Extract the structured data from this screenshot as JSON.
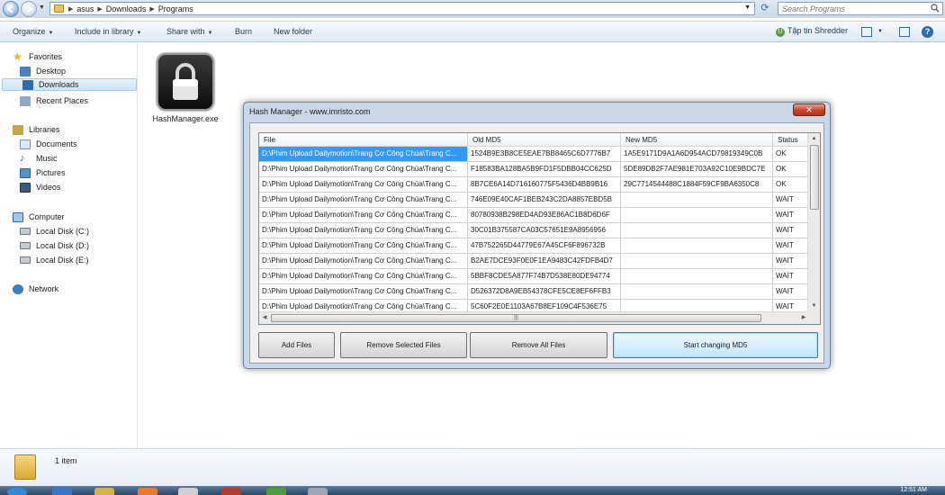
{
  "address": {
    "breadcrumb": [
      "asus",
      "Downloads",
      "Programs"
    ],
    "search_placeholder": "Search Programs"
  },
  "toolbar": {
    "organize": "Organize",
    "include_in_library": "Include in library",
    "share_with": "Share with",
    "burn": "Burn",
    "new_folder": "New folder",
    "shredder": "Tập tin Shredder"
  },
  "sidebar": {
    "favorites": "Favorites",
    "desktop": "Desktop",
    "downloads": "Downloads",
    "recent_places": "Recent Places",
    "libraries": "Libraries",
    "documents": "Documents",
    "music": "Music",
    "pictures": "Pictures",
    "videos": "Videos",
    "computer": "Computer",
    "disk_c": "Local Disk (C:)",
    "disk_d": "Local Disk (D:)",
    "disk_e": "Local Disk (E:)",
    "network": "Network"
  },
  "content": {
    "file_name": "HashManager.exe"
  },
  "dialog": {
    "title": "Hash Manager - www.imristo.com",
    "columns": [
      "File",
      "Old MD5",
      "New MD5",
      "Status"
    ],
    "rows": [
      {
        "file": "D:\\Phim Upload Dailymotion\\Trang Cơ Công Chúa\\Trang C...",
        "old": "1524B9E3B8CE5EAE7BB8465C6D7776B7",
        "new": "1A5E9171D9A1A6D954ACD79819349C0B",
        "status": "OK"
      },
      {
        "file": "D:\\Phim Upload Dailymotion\\Trang Cơ Công Chúa\\Trang C...",
        "old": "F18583BA128BA5B9FD1F5DBB04CC625D",
        "new": "5DE89DB2F7AE981E703A92C10E9BDC7E",
        "status": "OK"
      },
      {
        "file": "D:\\Phim Upload Dailymotion\\Trang Cơ Công Chúa\\Trang C...",
        "old": "8B7CE6A14D716160775F5436D4BB9B16",
        "new": "29C7714544488C1884F59CF9BA6350C8",
        "status": "OK"
      },
      {
        "file": "D:\\Phim Upload Dailymotion\\Trang Cơ Công Chúa\\Trang C...",
        "old": "746E09E40CAF1BEB243C2DA8857EBD5B",
        "new": "",
        "status": "WAIT"
      },
      {
        "file": "D:\\Phim Upload Dailymotion\\Trang Cơ Công Chúa\\Trang C...",
        "old": "80780938B298ED4AD93E86AC1B8D6D6F",
        "new": "",
        "status": "WAIT"
      },
      {
        "file": "D:\\Phim Upload Dailymotion\\Trang Cơ Công Chúa\\Trang C...",
        "old": "30C01B375587CA03C57651E9A8956956",
        "new": "",
        "status": "WAIT"
      },
      {
        "file": "D:\\Phim Upload Dailymotion\\Trang Cơ Công Chúa\\Trang C...",
        "old": "47B752265D44779E67A45CF6F896732B",
        "new": "",
        "status": "WAIT"
      },
      {
        "file": "D:\\Phim Upload Dailymotion\\Trang Cơ Công Chúa\\Trang C...",
        "old": "B2AE7DCE93F0E0F1EA9483C42FDFB4D7",
        "new": "",
        "status": "WAIT"
      },
      {
        "file": "D:\\Phim Upload Dailymotion\\Trang Cơ Công Chúa\\Trang C...",
        "old": "5BBF8CDE5A877F74B7D538E80DE94774",
        "new": "",
        "status": "WAIT"
      },
      {
        "file": "D:\\Phim Upload Dailymotion\\Trang Cơ Công Chúa\\Trang C...",
        "old": "D526372D8A9EB54378CFE5CE8EF6FFB3",
        "new": "",
        "status": "WAIT"
      },
      {
        "file": "D:\\Phim Upload Dailymotion\\Trang Cơ Công Chúa\\Trang C...",
        "old": "5C60F2E0E1103A67B8EF109C4F536E75",
        "new": "",
        "status": "WAIT"
      }
    ],
    "buttons": {
      "add_files": "Add Files",
      "remove_selected": "Remove Selected Files",
      "remove_all": "Remove All Files",
      "start": "Start changing MD5"
    }
  },
  "details": {
    "count": "1 item"
  },
  "taskbar": {
    "clock": "12:51 AM"
  }
}
